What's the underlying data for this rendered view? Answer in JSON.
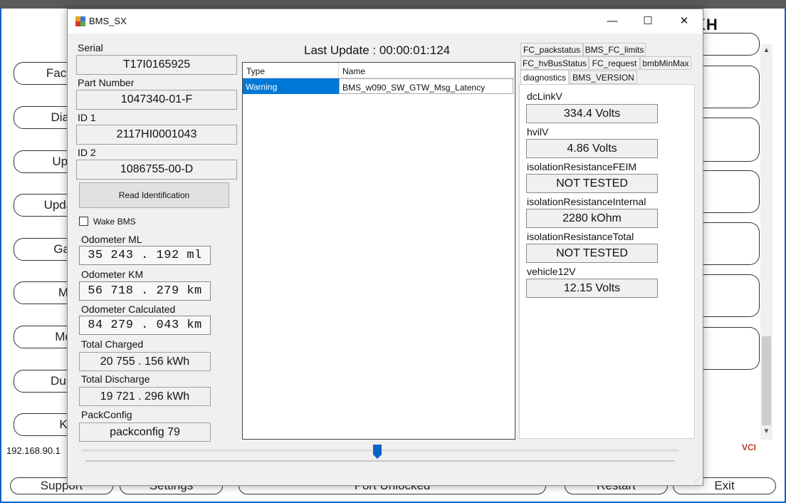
{
  "background_app": {
    "title_partial": "KH",
    "left_buttons": [
      "Factor",
      "Diag",
      "Upo",
      "Update",
      "Gat",
      "M",
      "Mo",
      "Dum",
      "K"
    ],
    "bottom_buttons": [
      "Support",
      "Settings",
      "Port Unlocked",
      "Restart",
      "Exit"
    ],
    "ip_text": "192.168.90.1",
    "vci_label": "VCI"
  },
  "window": {
    "title": "BMS_SX",
    "minimize": "—",
    "maximize": "☐",
    "close": "✕"
  },
  "identification": {
    "serial_label": "Serial",
    "serial_value": "T17I0165925",
    "part_number_label": "Part Number",
    "part_number_value": "1047340-01-F",
    "id1_label": "ID 1",
    "id1_value": "2117HI0001043",
    "id2_label": "ID 2",
    "id2_value": "1086755-00-D",
    "read_button": "Read Identification"
  },
  "wake_bms": {
    "label": "Wake BMS",
    "checked": false
  },
  "odometer": {
    "ml_label": "Odometer ML",
    "ml_value": "35 243 . 192 ml",
    "km_label": "Odometer KM",
    "km_value": "56 718 . 279 km",
    "calc_label": "Odometer Calculated",
    "calc_value": "84 279 . 043 km"
  },
  "energy": {
    "charged_label": "Total Charged",
    "charged_value": "20 755 . 156 kWh",
    "discharge_label": "Total Discharge",
    "discharge_value": "19 721 . 296 kWh",
    "packconfig_label": "PackConfig",
    "packconfig_value": "packconfig 79"
  },
  "alerts": {
    "last_update": "Last Update : 00:00:01:124",
    "columns": [
      "Type",
      "Name"
    ],
    "rows": [
      {
        "type": "Warning",
        "name": "BMS_w090_SW_GTW_Msg_Latency"
      }
    ]
  },
  "tabs": {
    "row1": [
      "FC_packstatus",
      "BMS_FC_limits"
    ],
    "row2": [
      "FC_hvBusStatus",
      "FC_request",
      "bmbMinMax"
    ],
    "row3": [
      "diagnostics",
      "BMS_VERSION"
    ],
    "active": "diagnostics"
  },
  "diagnostics": [
    {
      "label": "dcLinkV",
      "value": "334.4 Volts"
    },
    {
      "label": "hvilV",
      "value": "4.86 Volts"
    },
    {
      "label": "isolationResistanceFEIM",
      "value": "NOT TESTED"
    },
    {
      "label": "isolationResistanceInternal",
      "value": "2280 kOhm"
    },
    {
      "label": "isolationResistanceTotal",
      "value": "NOT TESTED"
    },
    {
      "label": "vehicle12V",
      "value": "12.15 Volts"
    }
  ],
  "colors": {
    "selection": "#0078d7",
    "accent_border": "#0a63c9",
    "slider_thumb": "#0a63c9"
  }
}
